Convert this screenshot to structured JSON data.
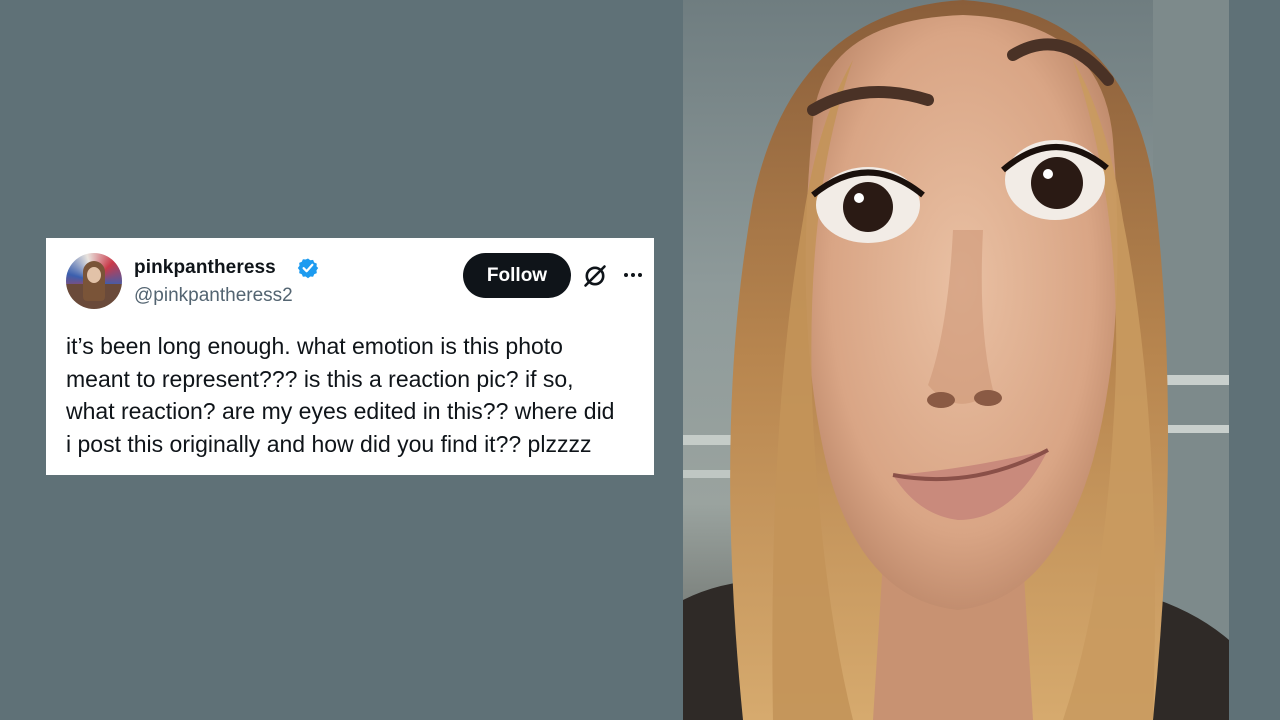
{
  "tweet": {
    "display_name": "pinkpantheress",
    "handle": "@pinkpantheress2",
    "follow_label": "Follow",
    "text": "it’s been long enough. what emotion is this photo\nmeant to represent??? is this a reaction pic? if so,\nwhat reaction? are my eyes edited in this?? where did\ni post this originally and how did you find it?? plzzzz",
    "verified_icon": "verified-badge-icon",
    "grok_icon": "grok-icon",
    "more_icon": "more-options-icon"
  },
  "colors": {
    "background": "#5f7177",
    "card": "#ffffff",
    "text_primary": "#0f1419",
    "text_secondary": "#536471",
    "verified_blue": "#1d9bf0",
    "follow_button": "#0f1419"
  }
}
